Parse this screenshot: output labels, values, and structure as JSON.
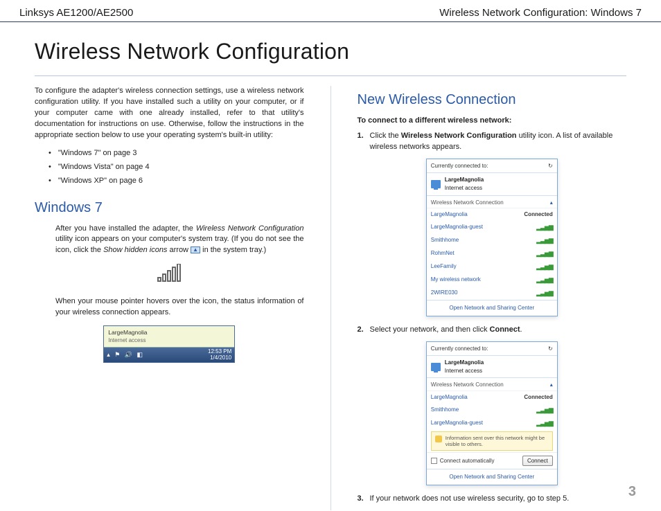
{
  "header": {
    "left": "Linksys AE1200/AE2500",
    "right": "Wireless Network Configuration: Windows 7"
  },
  "title": "Wireless Network Configuration",
  "left_col": {
    "intro": "To configure the adapter's wireless connection settings, use a wireless network configuration utility. If you have installed such a utility on your computer, or if your computer came with one already installed, refer to that utility's documentation for instructions on use. Otherwise, follow the instructions in the appropriate section below to use your operating system's built-in utility:",
    "bullets": [
      "\"Windows 7\" on page 3",
      "\"Windows Vista\" on page 4",
      "\"Windows XP\" on page 6"
    ],
    "h2": "Windows 7",
    "p1_a": "After you have installed the adapter, the ",
    "p1_i": "Wireless Network Configuration",
    "p1_b": " utility icon appears on your computer's system tray. (If you do not see the icon, click the ",
    "p1_c": "Show hidden icons",
    "p1_d": " arrow ",
    "p1_e": " in the system tray.)",
    "p2": "When your mouse pointer hovers over the icon, the status information of your wireless connection appears.",
    "tray": {
      "ssid": "LargeMagnolia",
      "status": "Internet access",
      "time": "12:53 PM",
      "date": "1/4/2010"
    }
  },
  "right_col": {
    "h2": "New Wireless Connection",
    "lead": "To connect to a different wireless network:",
    "step1_a": "Click the ",
    "step1_b": "Wireless Network Configuration",
    "step1_c": " utility icon. A list of available wireless networks appears.",
    "step2_a": "Select your network, and then click ",
    "step2_b": "Connect",
    "step2_c": ".",
    "step3": "If your network does not use wireless security, go to step 5.",
    "popup": {
      "head": "Currently connected to:",
      "conn_name": "LargeMagnolia",
      "conn_sub": "Internet access",
      "section": "Wireless Network Connection",
      "networks1": [
        {
          "name": "LargeMagnolia",
          "status": "Connected"
        },
        {
          "name": "LargeMagnolia-guest",
          "status": ""
        },
        {
          "name": "Smithhome",
          "status": ""
        },
        {
          "name": "RohmNet",
          "status": ""
        },
        {
          "name": "LeeFamily",
          "status": ""
        },
        {
          "name": "My wireless network",
          "status": ""
        },
        {
          "name": "2WIRE030",
          "status": ""
        }
      ],
      "networks2": [
        {
          "name": "LargeMagnolia",
          "status": "Connected"
        },
        {
          "name": "Smithhome",
          "status": ""
        },
        {
          "name": "LargeMagnolia-guest",
          "status": ""
        }
      ],
      "warn": "Information sent over this network might be visible to others.",
      "auto": "Connect automatically",
      "btn": "Connect",
      "footer": "Open Network and Sharing Center"
    }
  },
  "page_num": "3"
}
